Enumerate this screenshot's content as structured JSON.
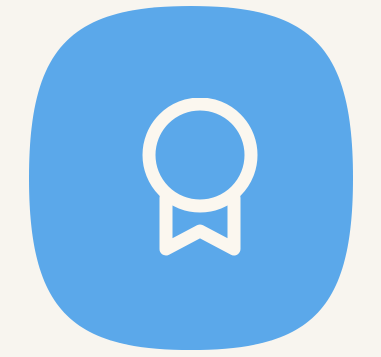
{
  "background_color": "#f8f5ef",
  "app_icon": {
    "icon": "award-ribbon-icon",
    "tile_color": "#5ba8ea",
    "glyph_color": "#fbf7ef"
  }
}
